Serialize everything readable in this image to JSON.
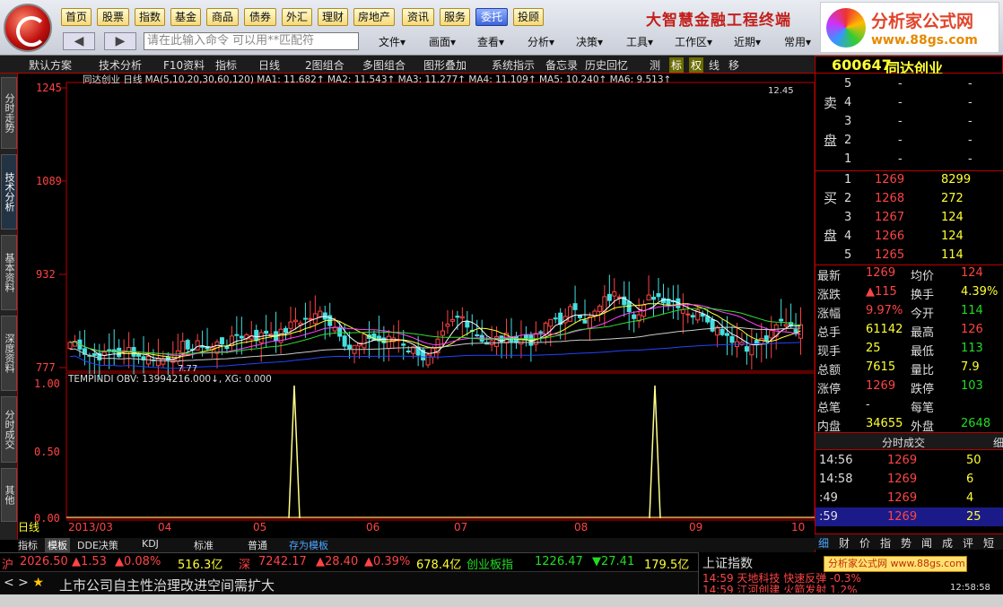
{
  "app": {
    "brand": "大智慧金融工程终端",
    "ad_title": "分析家公式网",
    "ad_url": "www.88gs.com"
  },
  "nav": [
    "首页",
    "股票",
    "指数",
    "基金",
    "商品",
    "债券",
    "外汇",
    "理财",
    "房地产",
    "资讯",
    "服务",
    "委托",
    "投顾"
  ],
  "nav_active": "委托",
  "command_placeholder": "请在此输入命令   可以用**匹配符",
  "menus": [
    "文件▾",
    "画面▾",
    "查看▾",
    "分析▾",
    "决策▾",
    "工具▾",
    "工作区▾",
    "近期▾",
    "常用▾"
  ],
  "toolbar2": {
    "items": [
      "默认方案",
      "技术分析",
      "F10资料",
      "指标",
      "日线",
      "2图组合",
      "多图组合",
      "图形叠加",
      "系统指示",
      "备忘录",
      "历史回忆",
      "测",
      "标",
      "权",
      "线",
      "移"
    ]
  },
  "stock": {
    "code": "600647",
    "name": "同达创业"
  },
  "left_tabs": [
    "分时走势",
    "技术分析",
    "基本资料",
    "深度资料",
    "分时成交",
    "其他"
  ],
  "chart": {
    "header": "同达创业 日线  MA(5,10,20,30,60,120)  MA1: 11.682↑  MA2: 11.543↑  MA3: 11.277↑  MA4: 11.109↑  MA5: 10.240↑  MA6: 9.513↑",
    "price_axis": [
      "1245",
      "1089",
      "932",
      "777"
    ],
    "high_label": "12.45",
    "low_label": "7.77",
    "indicator_header": "TEMPINDI  OBV: 13994216.000↓, XG: 0.000",
    "indicator_axis": [
      "1.00",
      "0.50",
      "0.00"
    ],
    "date_labels": [
      "2013/03",
      "04",
      "05",
      "06",
      "07",
      "08",
      "09",
      "10"
    ],
    "period_label": "日线"
  },
  "chart_data": {
    "type": "line",
    "title": "同达创业 日线",
    "series": [
      {
        "name": "MA1",
        "last": 11.682
      },
      {
        "name": "MA2",
        "last": 11.543
      },
      {
        "name": "MA3",
        "last": 11.277
      },
      {
        "name": "MA4",
        "last": 11.109
      },
      {
        "name": "MA5",
        "last": 10.24
      },
      {
        "name": "MA6",
        "last": 9.513
      }
    ],
    "ylim": [
      7.77,
      12.45
    ]
  },
  "orderbook": {
    "sell": [
      {
        "lvl": "5",
        "price": "-",
        "vol": "-"
      },
      {
        "lvl": "4",
        "price": "-",
        "vol": "-"
      },
      {
        "lvl": "3",
        "price": "-",
        "vol": "-"
      },
      {
        "lvl": "2",
        "price": "-",
        "vol": "-"
      },
      {
        "lvl": "1",
        "price": "-",
        "vol": "-"
      }
    ],
    "buy": [
      {
        "lvl": "1",
        "price": "1269",
        "vol": "8299"
      },
      {
        "lvl": "2",
        "price": "1268",
        "vol": "272"
      },
      {
        "lvl": "3",
        "price": "1267",
        "vol": "124"
      },
      {
        "lvl": "4",
        "price": "1266",
        "vol": "124"
      },
      {
        "lvl": "5",
        "price": "1265",
        "vol": "114"
      }
    ],
    "sell_label": [
      "卖",
      "盘"
    ],
    "buy_label": [
      "买",
      "盘"
    ]
  },
  "quote": [
    {
      "l1": "最新",
      "v1": "1269",
      "l2": "均价",
      "v2": "124"
    },
    {
      "l1": "涨跌",
      "v1": "▲115",
      "l2": "换手",
      "v2": "4.39%"
    },
    {
      "l1": "涨幅",
      "v1": "9.97%",
      "l2": "今开",
      "v2": "114"
    },
    {
      "l1": "总手",
      "v1": "61142",
      "l2": "最高",
      "v2": "126"
    },
    {
      "l1": "现手",
      "v1": "25",
      "l2": "最低",
      "v2": "113"
    },
    {
      "l1": "总额",
      "v1": "7615",
      "l2": "量比",
      "v2": "7.9"
    },
    {
      "l1": "涨停",
      "v1": "1269",
      "l2": "跌停",
      "v2": "103"
    },
    {
      "l1": "总笔",
      "v1": "-",
      "l2": "每笔",
      "v2": ""
    },
    {
      "l1": "内盘",
      "v1": "34655",
      "l2": "外盘",
      "v2": "2648"
    }
  ],
  "ticks_title": "分时成交",
  "ticks_tab": "细",
  "ticks": [
    {
      "time": "14:56",
      "price": "1269",
      "vol": "50"
    },
    {
      "time": "14:58",
      "price": "1269",
      "vol": "6"
    },
    {
      "time": ":49",
      "price": "1269",
      "vol": "4"
    },
    {
      "time": ":59",
      "price": "1269",
      "vol": "25"
    }
  ],
  "bottom_tabs": [
    "细",
    "财",
    "价",
    "指",
    "势",
    "闻",
    "成",
    "评",
    "短"
  ],
  "sub_tabs": [
    "指标",
    "模板",
    "DDE决策",
    "KDJ",
    "标准",
    "普通",
    "存为模板"
  ],
  "indices": {
    "sh": {
      "name": "沪",
      "value": "2026.50",
      "chg": "▲1.53",
      "pct": "▲0.08%",
      "amt": "516.3亿"
    },
    "sz": {
      "name": "深",
      "value": "7242.17",
      "chg": "▲28.40",
      "pct": "▲0.39%",
      "amt": "678.4亿"
    },
    "cy": {
      "name": "创业板指",
      "value": "1226.47",
      "chg": "▼27.41",
      "amt": "179.5亿"
    }
  },
  "news": "上市公司自主性治理改进空间需扩大",
  "right_news": {
    "title": "上证指数",
    "line1": "14:59 天地科技 快速反弹 -0.3%",
    "line2": "14:59 江河创建 火箭发射 1.2%",
    "time": "12:58:58"
  },
  "ad_strip": "分析家公式网 www.88gs.com"
}
